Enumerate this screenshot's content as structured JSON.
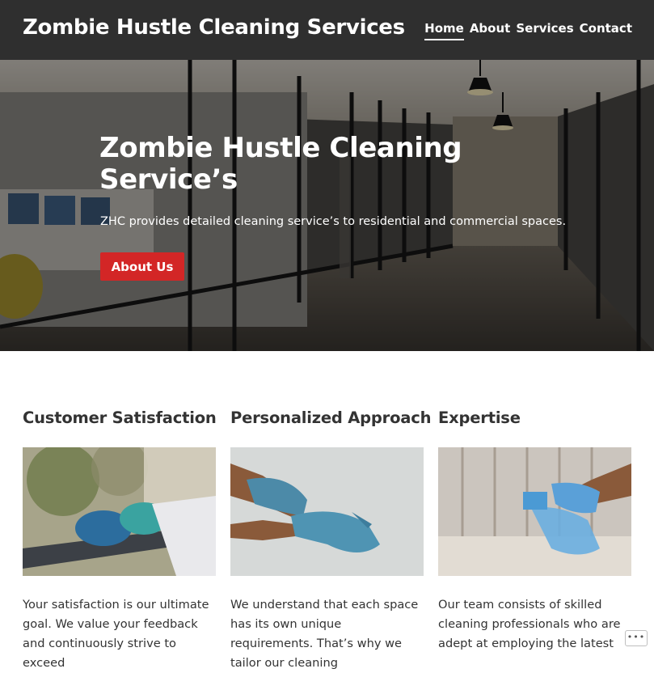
{
  "header": {
    "site_title": "Zombie Hustle Cleaning Services",
    "nav": [
      {
        "label": "Home",
        "active": true
      },
      {
        "label": "About",
        "active": false
      },
      {
        "label": "Services",
        "active": false
      },
      {
        "label": "Contact",
        "active": false
      }
    ]
  },
  "hero": {
    "title": "Zombie Hustle Cleaning Service’s",
    "text": "ZHC provides detailed cleaning service’s to residential and commercial spaces.",
    "button_label": "About Us",
    "button_color": "#d32626"
  },
  "features": [
    {
      "heading": "Customer Satisfaction",
      "image": "hand-wiping-railing-with-cloth",
      "text": "Your satisfaction is our ultimate goal. We value your feedback and continuously strive to exceed"
    },
    {
      "heading": "Personalized Approach",
      "image": "hands-putting-on-blue-gloves",
      "text": "We understand that each space has its own unique requirements. That’s why we tailor our cleaning"
    },
    {
      "heading": "Expertise",
      "image": "gloved-hand-with-spray-bottle",
      "text": "Our team consists of skilled cleaning professionals who are adept at employing the latest"
    }
  ],
  "widgets": {
    "more_icon": "ellipsis-icon",
    "more_label": "•••"
  },
  "colors": {
    "header_bg": "#2f2f2f",
    "accent": "#d32626",
    "text": "#333333"
  }
}
